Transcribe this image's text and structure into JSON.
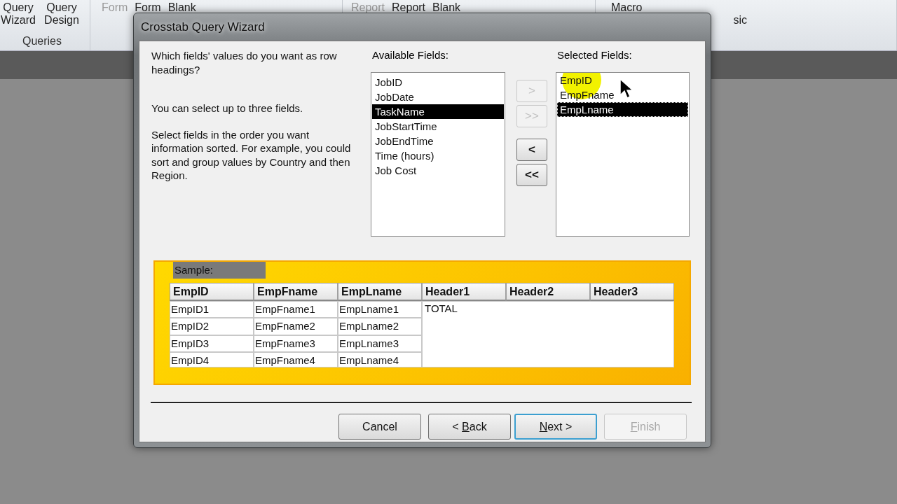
{
  "ribbon": {
    "groups": [
      {
        "label": "Queries",
        "items": [
          {
            "label": "Query Wizard",
            "disabled": false
          },
          {
            "label": "Query Design",
            "disabled": false
          }
        ]
      },
      {
        "items": [
          {
            "label": "Form",
            "disabled": true
          },
          {
            "label": "Form",
            "disabled": false
          },
          {
            "label": "Blank",
            "disabled": false
          }
        ]
      },
      {
        "items": [
          {
            "label": "Report",
            "disabled": true
          },
          {
            "label": "Report",
            "disabled": false
          },
          {
            "label": "Blank",
            "disabled": false
          }
        ]
      },
      {
        "items": [
          {
            "label": "Macro",
            "disabled": false
          },
          {
            "label": "sic",
            "disabled": false
          }
        ]
      }
    ]
  },
  "window": {
    "title": "Crosstab Query Wizard"
  },
  "instructions": [
    "Which fields' values do you want as row headings?",
    "You can select up to three fields.",
    "Select fields in the order you want information sorted.  For example, you could sort and group values by Country and then Region."
  ],
  "available_fields": {
    "label": "Available Fields:",
    "items": [
      {
        "label": "JobID",
        "selected": false
      },
      {
        "label": "JobDate",
        "selected": false
      },
      {
        "label": "TaskName",
        "selected": true
      },
      {
        "label": "JobStartTime",
        "selected": false
      },
      {
        "label": "JobEndTime",
        "selected": false
      },
      {
        "label": "Time (hours)",
        "selected": false
      },
      {
        "label": "Job Cost",
        "selected": false
      }
    ]
  },
  "transfer_buttons": [
    {
      "label": ">",
      "disabled": true
    },
    {
      "label": ">>",
      "disabled": true
    },
    {
      "label": "<",
      "disabled": false
    },
    {
      "label": "<<",
      "disabled": false
    }
  ],
  "selected_fields": {
    "label": "Selected Fields:",
    "items": [
      {
        "label": "EmpID",
        "selected": false
      },
      {
        "label": "EmpFname",
        "selected": false
      },
      {
        "label": "EmpLname",
        "selected": true
      }
    ]
  },
  "sample": {
    "label": "Sample:",
    "columns": [
      "EmpID",
      "EmpFname",
      "EmpLname",
      "Header1",
      "Header2",
      "Header3"
    ],
    "rows": [
      [
        "EmpID1",
        "EmpFname1",
        "EmpLname1"
      ],
      [
        "EmpID2",
        "EmpFname2",
        "EmpLname2"
      ],
      [
        "EmpID3",
        "EmpFname3",
        "EmpLname3"
      ],
      [
        "EmpID4",
        "EmpFname4",
        "EmpLname4"
      ]
    ],
    "value": "TOTAL"
  },
  "buttons": [
    {
      "before": "Cancel",
      "disabled": false,
      "default": false
    },
    {
      "before": "< ",
      "key": "B",
      "after": "ack",
      "disabled": false,
      "default": false
    },
    {
      "key": "N",
      "after": "ext >",
      "disabled": false,
      "default": true
    },
    {
      "key": "F",
      "after": "inish",
      "disabled": true,
      "default": false
    }
  ]
}
